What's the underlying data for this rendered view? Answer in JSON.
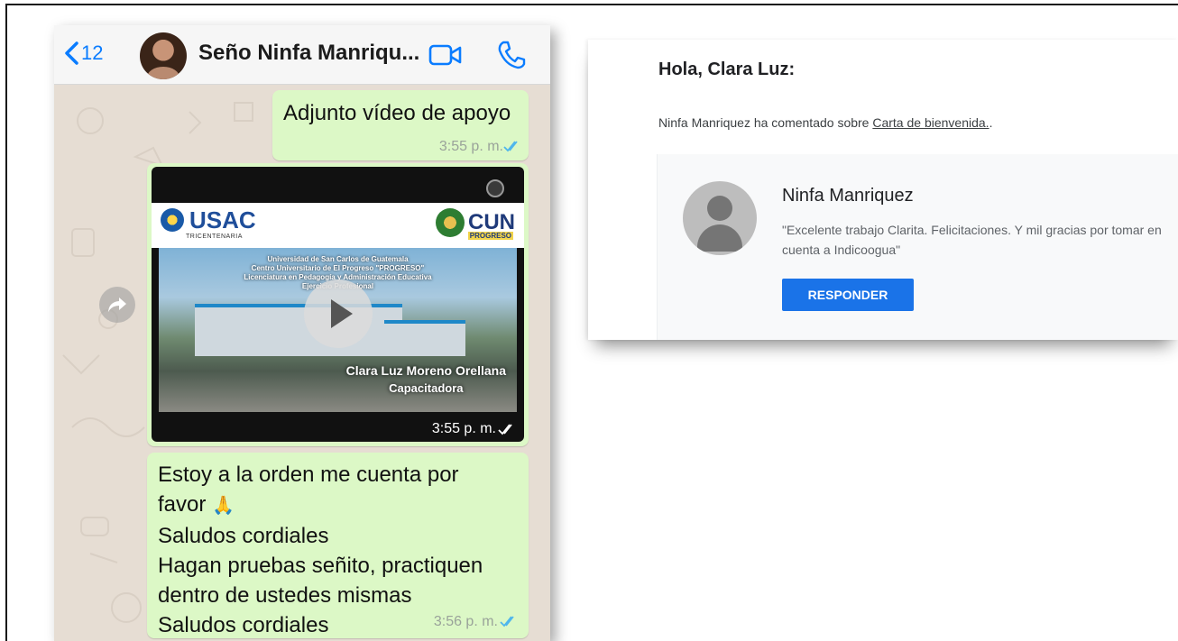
{
  "whatsapp": {
    "back_count": "12",
    "contact_name": "Seño Ninfa Manriqu...",
    "icons": {
      "back": "chevron-left-icon",
      "video": "video-call-icon",
      "call": "phone-icon",
      "forward": "forward-icon"
    },
    "colors": {
      "accent": "#0a7cff",
      "bubble": "#dcf8c6",
      "read_ticks": "#4fb6ec"
    },
    "messages": [
      {
        "text": "Adjunto vídeo de apoyo",
        "time": "3:55 p. m."
      },
      {
        "type": "video",
        "time": "3:55 p. m.",
        "thumbnail": {
          "left_logo": "USAC",
          "left_logo_sub": "TRICENTENARIA",
          "right_logo": "CUN",
          "right_logo_sub": "PROGRESO",
          "lines": [
            "Universidad de San Carlos de Guatemala",
            "Centro Universitario de El Progreso \"PROGRESO\"",
            "Licenciatura en Pedagogía y Administración Educativa",
            "Ejercicio Profesional"
          ],
          "presenter": "Clara Luz Moreno Orellana",
          "role": "Capacitadora"
        }
      },
      {
        "text": "Estoy a la orden me cuenta por\nfavor",
        "emoji": "🙏",
        "text2": "Saludos cordiales\nHagan pruebas señito, practiquen\ndentro de ustedes mismas\nSaludos cordiales",
        "time": "3:56 p. m."
      }
    ]
  },
  "email": {
    "greeting": "Hola, Clara Luz:",
    "notice_prefix": "Ninfa Manriquez ha comentado sobre ",
    "notice_link": "Carta de bienvenida.",
    "notice_suffix": ".",
    "comment": {
      "author": "Ninfa Manriquez",
      "text": "\"Excelente trabajo Clarita. Felicitaciones. Y mil gracias por tomar en cuenta a Indicoogua\""
    },
    "reply_label": "RESPONDER",
    "colors": {
      "button": "#1a73e8"
    }
  }
}
